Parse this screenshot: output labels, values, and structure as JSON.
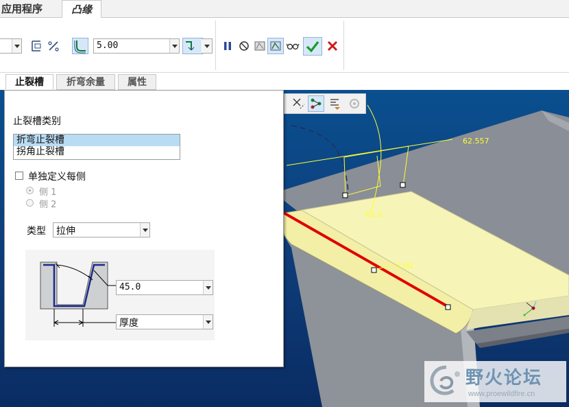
{
  "ribbon": {
    "tabs": [
      {
        "label": "应用程序"
      },
      {
        "label": "凸缘"
      }
    ]
  },
  "toolbar": {
    "length_value": "5.00"
  },
  "panel_tabs": [
    {
      "label": "止裂槽"
    },
    {
      "label": "折弯余量"
    },
    {
      "label": "属性"
    }
  ],
  "relief_panel": {
    "category_label": "止裂槽类别",
    "category_items": [
      {
        "label": "折弯止裂槽",
        "selected": true
      },
      {
        "label": "拐角止裂槽",
        "selected": false
      }
    ],
    "single_side_label": "单独定义每侧",
    "single_side_checked": false,
    "sides": [
      {
        "label": "侧 1",
        "selected": true
      },
      {
        "label": "侧 2",
        "selected": false
      }
    ],
    "type_label": "类型",
    "type_value": "拉伸",
    "angle_value": "45.0",
    "width_value": "厚度"
  },
  "viewport": {
    "dim_labels": [
      "62.557",
      "62.2",
      "3.00"
    ]
  },
  "watermark": {
    "title": "野火论坛",
    "url": "www.proewildfire.cn"
  },
  "colors": {
    "viewport_top": "#0a4f8f",
    "viewport_bottom": "#0a2c63",
    "highlight_surface": "#f7f4b8",
    "edge_highlight": "#e00000",
    "dimension_yellow": "#ffff33",
    "part_gray": "#8a8e96"
  }
}
